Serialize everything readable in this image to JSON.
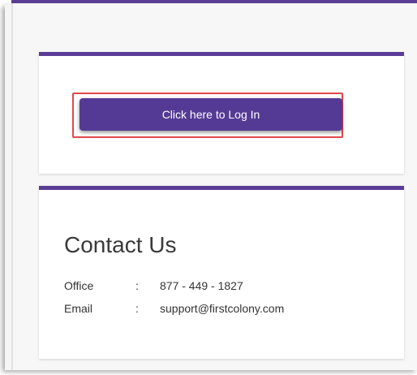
{
  "login": {
    "button_label": "Click here to Log In"
  },
  "contact": {
    "title": "Contact Us",
    "office_label": "Office",
    "office_sep": ":",
    "office_value": "877 - 449 - 1827",
    "email_label": "Email",
    "email_sep": ":",
    "email_value": "support@firstcolony.com"
  },
  "colors": {
    "accent": "#5b3d96",
    "button": "#553a95",
    "highlight": "#e0484c"
  }
}
